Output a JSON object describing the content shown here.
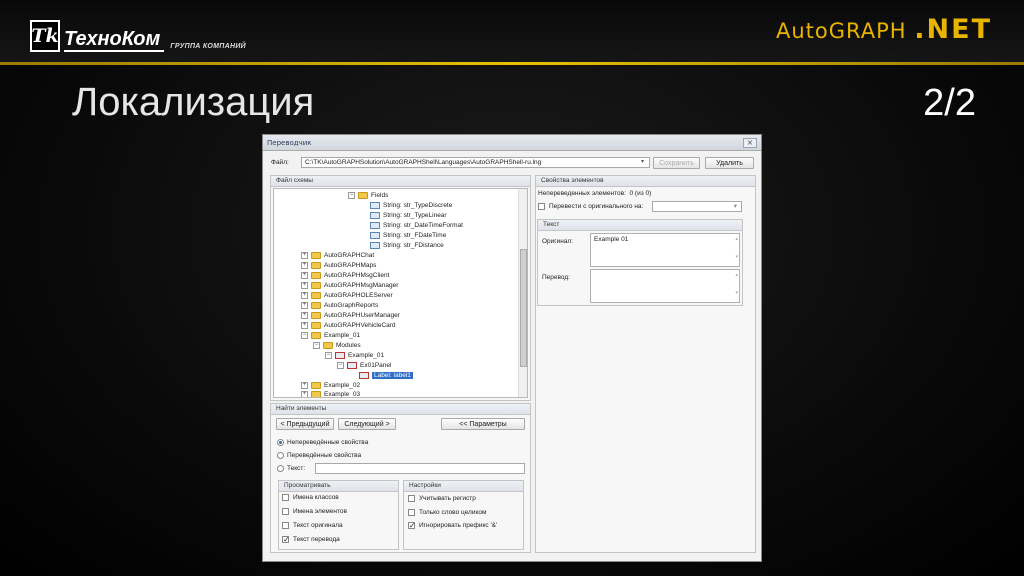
{
  "slide": {
    "company": "ТехноКом",
    "company_sub": "ГРУППА КОМПАНИЙ",
    "product_main": "AutoGRAPH",
    "product_suffix": ".NET",
    "title": "Локализация",
    "page": "2/2",
    "accent": "#e8b400"
  },
  "window": {
    "title": "Переводчик",
    "file_label": "Файл:",
    "file_value": "C:\\TK\\AutoGRAPHSolution\\AutoGRAPHShell\\Languages\\AutoGRAPHShell-ru.lng",
    "save_label": "Сохранить",
    "delete_label": "Удалить",
    "scheme_header": "Файл схемы",
    "tree": [
      {
        "label": "Fields",
        "kind": "folder",
        "pm": "−"
      },
      {
        "label": "String: str_TypeDiscrete",
        "kind": "string"
      },
      {
        "label": "String: str_TypeLinear",
        "kind": "string"
      },
      {
        "label": "String: str_DateTimeFormat",
        "kind": "string"
      },
      {
        "label": "String: str_FDateTime",
        "kind": "string"
      },
      {
        "label": "String: str_FDistance",
        "kind": "string"
      },
      {
        "label": "AutoGRAPHChat",
        "kind": "folder",
        "pm": "+"
      },
      {
        "label": "AutoGRAPHMaps",
        "kind": "folder",
        "pm": "+"
      },
      {
        "label": "AutoGRAPHMsgClient",
        "kind": "folder",
        "pm": "+"
      },
      {
        "label": "AutoGRAPHMsgManager",
        "kind": "folder",
        "pm": "+"
      },
      {
        "label": "AutoGRAPHOLEServer",
        "kind": "folder",
        "pm": "+"
      },
      {
        "label": "AutoGraphReports",
        "kind": "folder",
        "pm": "+"
      },
      {
        "label": "AutoGRAPHUserManager",
        "kind": "folder",
        "pm": "+"
      },
      {
        "label": "AutoGRAPHVehicleCard",
        "kind": "folder",
        "pm": "+"
      },
      {
        "label": "Example_01",
        "kind": "folder",
        "pm": "−"
      },
      {
        "label": "Modules",
        "kind": "folder",
        "pm": "−"
      },
      {
        "label": "Example_01",
        "kind": "label",
        "pm": "−"
      },
      {
        "label": "Ex01Panel",
        "kind": "label",
        "pm": "−"
      },
      {
        "label": "Label: label1",
        "kind": "label",
        "selected": true
      },
      {
        "label": "Example_02",
        "kind": "folder",
        "pm": "+"
      },
      {
        "label": "Example_03",
        "kind": "folder",
        "pm": "+"
      }
    ],
    "find_header": "Найти элементы",
    "prev_label": "< Предыдущий",
    "next_label": "Следующий >",
    "params_label": "<< Параметры",
    "radio_untranslated": "Непереведённые свойства",
    "radio_translated": "Переведённые свойства",
    "radio_text": "Текст:",
    "view_header": "Просматривать",
    "view_class_names": "Имена классов",
    "view_element_names": "Имена элементов",
    "view_original_text": "Текст оригинала",
    "view_translation_text": "Текст перевода",
    "settings_header": "Настройки",
    "set_case": "Учитывать регистр",
    "set_whole_word": "Только слово целиком",
    "set_ignore_prefix": "Игнорировать префикс '&'",
    "props_header": "Свойства элементов",
    "untranslated_label": "Непереведенных элементов:",
    "untranslated_value": "0 (из 0)",
    "translate_from_label": "Перевести с оригинального на:",
    "text_header": "Текст",
    "original_label": "Оригинал:",
    "original_value": "Example 01",
    "translation_label": "Перевод:",
    "translation_value": ""
  }
}
